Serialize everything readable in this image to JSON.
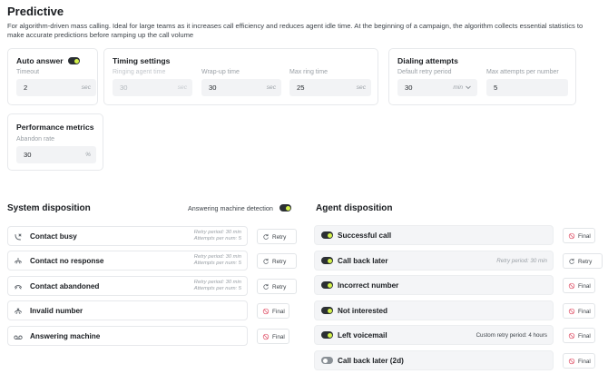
{
  "page": {
    "title": "Predictive",
    "description": "For algorithm-driven mass calling. Ideal for large teams as it increases call efficiency and reduces agent idle time. At the beginning of a campaign, the algorithm collects essential statistics to make accurate predictions before ramping up the call volume"
  },
  "auto_answer": {
    "title": "Auto answer",
    "toggle_on": true,
    "timeout_label": "Timeout",
    "timeout_value": "2",
    "timeout_unit": "sec"
  },
  "timing": {
    "title": "Timing settings",
    "ringing_label": "Ringing agent time",
    "ringing_value": "30",
    "ringing_unit": "sec",
    "wrapup_label": "Wrap-up time",
    "wrapup_value": "30",
    "wrapup_unit": "sec",
    "maxring_label": "Max ring time",
    "maxring_value": "25",
    "maxring_unit": "sec"
  },
  "dialing": {
    "title": "Dialing attempts",
    "retry_label": "Default retry period",
    "retry_value": "30",
    "retry_unit": "min",
    "max_attempts_label": "Max attempts per number",
    "max_attempts_value": "5"
  },
  "performance": {
    "title": "Performance metrics",
    "abandon_label": "Abandon rate",
    "abandon_value": "30",
    "abandon_unit": "%"
  },
  "system_disposition": {
    "title": "System disposition",
    "amd_label": "Answering machine detection",
    "amd_on": true,
    "rows": [
      {
        "name": "Contact busy",
        "icon": "phone-busy-icon",
        "meta_line1": "Retry period: 30 min",
        "meta_line2": "Attempts per num: 5",
        "action": "Retry"
      },
      {
        "name": "Contact no response",
        "icon": "phone-no-response-icon",
        "meta_line1": "Retry period: 30 min",
        "meta_line2": "Attempts per num: 5",
        "action": "Retry"
      },
      {
        "name": "Contact abandoned",
        "icon": "phone-abandoned-icon",
        "meta_line1": "Retry period: 30 min",
        "meta_line2": "Attempts per num: 5",
        "action": "Retry"
      },
      {
        "name": "Invalid number",
        "icon": "phone-invalid-icon",
        "action": "Final"
      },
      {
        "name": "Answering machine",
        "icon": "voicemail-icon",
        "action": "Final"
      }
    ]
  },
  "agent_disposition": {
    "title": "Agent disposition",
    "rows": [
      {
        "name": "Successful call",
        "toggle_on": true,
        "action": "Final"
      },
      {
        "name": "Call back later",
        "toggle_on": true,
        "meta": "Retry period: 30 min",
        "action": "Retry"
      },
      {
        "name": "Incorrect number",
        "toggle_on": true,
        "action": "Final"
      },
      {
        "name": "Not interested",
        "toggle_on": true,
        "action": "Final"
      },
      {
        "name": "Left voicemail",
        "toggle_on": true,
        "meta": "Custom retry period: 4 hours",
        "action": "Final"
      },
      {
        "name": "Call back later (2d)",
        "toggle_on": false,
        "action": "Final"
      }
    ]
  },
  "colors": {
    "toggle_track": "#2b2f33",
    "toggle_knob": "#d4f24a",
    "final_icon": "#e0546a",
    "retry_icon": "#5b6168"
  }
}
